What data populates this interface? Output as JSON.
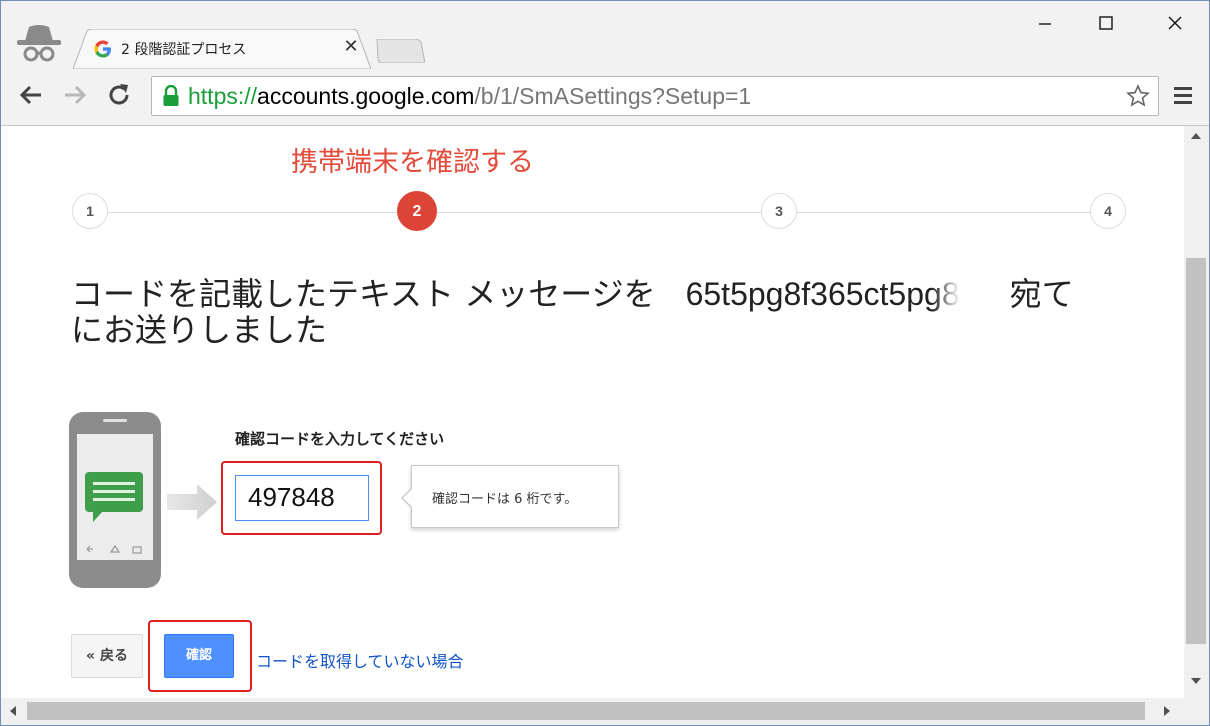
{
  "browser": {
    "tab_title": "2 段階認証プロセス",
    "tab_close": "✕",
    "url_scheme": "https://",
    "url_host": "accounts.google.com",
    "url_path": "/b/1/SmASettings?Setup=1"
  },
  "steps": {
    "current_title": "携帯端末を確認する",
    "items": [
      "1",
      "2",
      "3",
      "4"
    ],
    "active_index": 1
  },
  "main": {
    "heading_prefix": "コードを記載したテキスト メッセージを",
    "phone_number": "65t5pg8f365ct5pg8",
    "heading_dest": "宛て",
    "heading_line2": "にお送りしました",
    "code_label": "確認コードを入力してください",
    "code_value": "497848",
    "tip_text": "確認コードは 6 桁です。"
  },
  "actions": {
    "back_label": "« 戻る",
    "confirm_label": "確認",
    "no_code_link": "コードを取得していない場合"
  },
  "colors": {
    "accent_red": "#db4437",
    "step_title": "#e34b3a",
    "primary_button": "#4d90fe",
    "link": "#1155cc",
    "highlight_box": "#e02020",
    "secure_url": "#1a9e3a"
  }
}
